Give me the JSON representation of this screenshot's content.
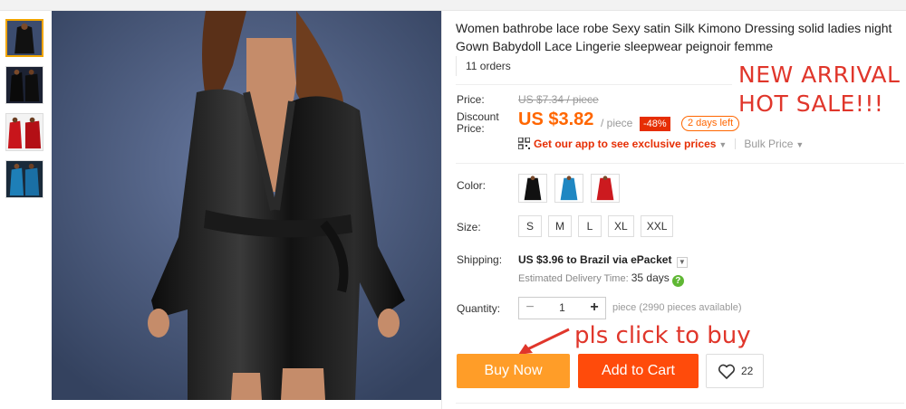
{
  "product": {
    "title": "Women bathrobe lace robe Sexy satin Silk Kimono Dressing solid ladies night Gown Babydoll Lace Lingerie sleepwear peignoir femme",
    "orders": "11 orders"
  },
  "pricing": {
    "price_label": "Price:",
    "original_price": "US $7.34 / piece",
    "discount_label_line1": "Discount",
    "discount_label_line2": "Price:",
    "discount_price": "US $3.82",
    "per_piece": "/ piece",
    "discount_badge": "-48%",
    "days_left": "2 days left",
    "app_prices": "Get our app to see exclusive prices",
    "bulk_price": "Bulk Price"
  },
  "overlay": {
    "line1": "NEW ARRIVAL",
    "line2": "HOT SALE!!!",
    "click_note": "pls click to buy"
  },
  "options": {
    "color_label": "Color:",
    "colors": [
      "black",
      "blue",
      "red"
    ],
    "size_label": "Size:",
    "sizes": [
      "S",
      "M",
      "L",
      "XL",
      "XXL"
    ]
  },
  "shipping": {
    "label": "Shipping:",
    "cost": "US $3.96",
    "destination": "to Brazil via ePacket",
    "delivery_label": "Estimated Delivery Time:",
    "delivery_days": "35 days"
  },
  "quantity": {
    "label": "Quantity:",
    "value": "1",
    "minus": "−",
    "plus": "+",
    "note": "piece (2990 pieces available)"
  },
  "actions": {
    "buy_now": "Buy Now",
    "add_to_cart": "Add to Cart",
    "wishlist_count": "22"
  },
  "colors": {
    "accent_orange": "#ff9d28",
    "cart_orange": "#ff4b0b",
    "price_orange": "#ff6600",
    "badge_red": "#e62e04",
    "overlay_red": "#e0362b"
  }
}
